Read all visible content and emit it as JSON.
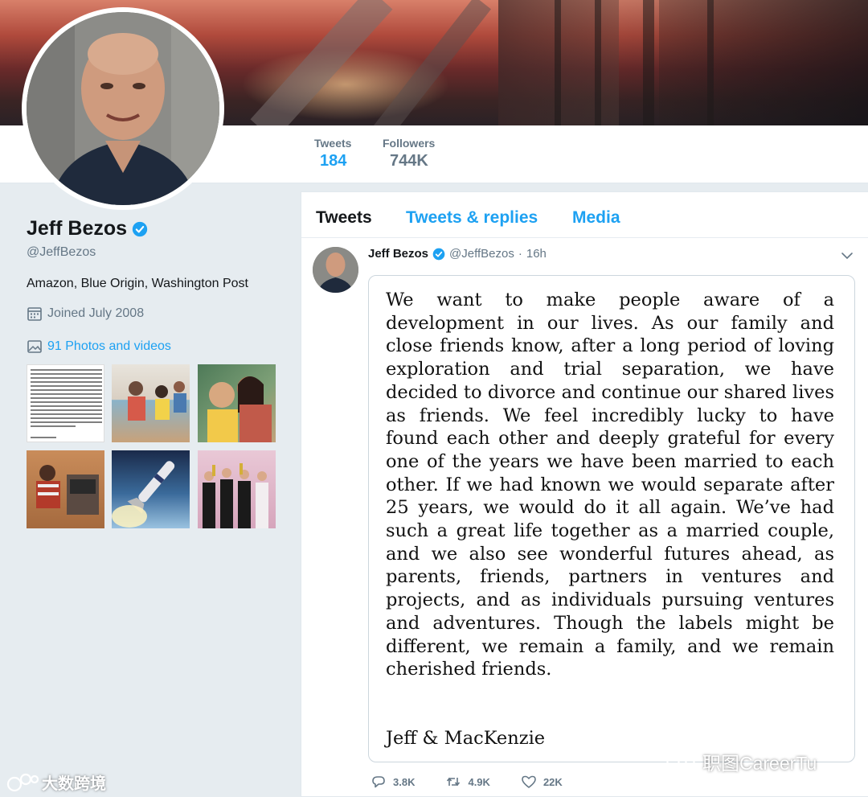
{
  "profile": {
    "name": "Jeff Bezos",
    "handle": "@JeffBezos",
    "bio": "Amazon, Blue Origin, Washington Post",
    "joined": "Joined July 2008",
    "photos_link": "91 Photos and videos"
  },
  "stats": {
    "tweets_label": "Tweets",
    "tweets_value": "184",
    "followers_label": "Followers",
    "followers_value": "744K"
  },
  "tabs": {
    "tweets": "Tweets",
    "replies": "Tweets & replies",
    "media": "Media"
  },
  "tweet": {
    "name": "Jeff Bezos",
    "handle": "@JeffBezos",
    "dot": "·",
    "time": "16h",
    "statement": "We want to make people aware of a development in our lives. As our family and close friends know, after a long period of loving exploration and trial separation, we have decided to divorce and continue our shared lives as friends.  We feel incredibly lucky to have found each other and deeply grateful for every one of the years we have been married to each other.  If we had known we would separate after 25 years, we would do it all again.  We’ve had such a great life together as a married couple, and we also see wonderful futures ahead, as parents, friends, partners in ventures and projects, and as individuals pursuing ventures and adventures.  Though the labels might be different, we remain a family, and we remain cherished friends.",
    "signature": "Jeff & MacKenzie",
    "replies": "3.8K",
    "retweets": "4.9K",
    "likes": "22K"
  },
  "watermarks": {
    "right": "职图CareerTu",
    "left": "大数跨境"
  },
  "colors": {
    "accent": "#1da1f2",
    "muted": "#657786",
    "background": "#e6ecf0"
  },
  "icons": {
    "verified": "verified-badge-icon",
    "calendar": "calendar-icon",
    "photo": "photo-icon",
    "caret": "chevron-down-icon",
    "reply": "reply-icon",
    "retweet": "retweet-icon",
    "like": "heart-icon"
  }
}
